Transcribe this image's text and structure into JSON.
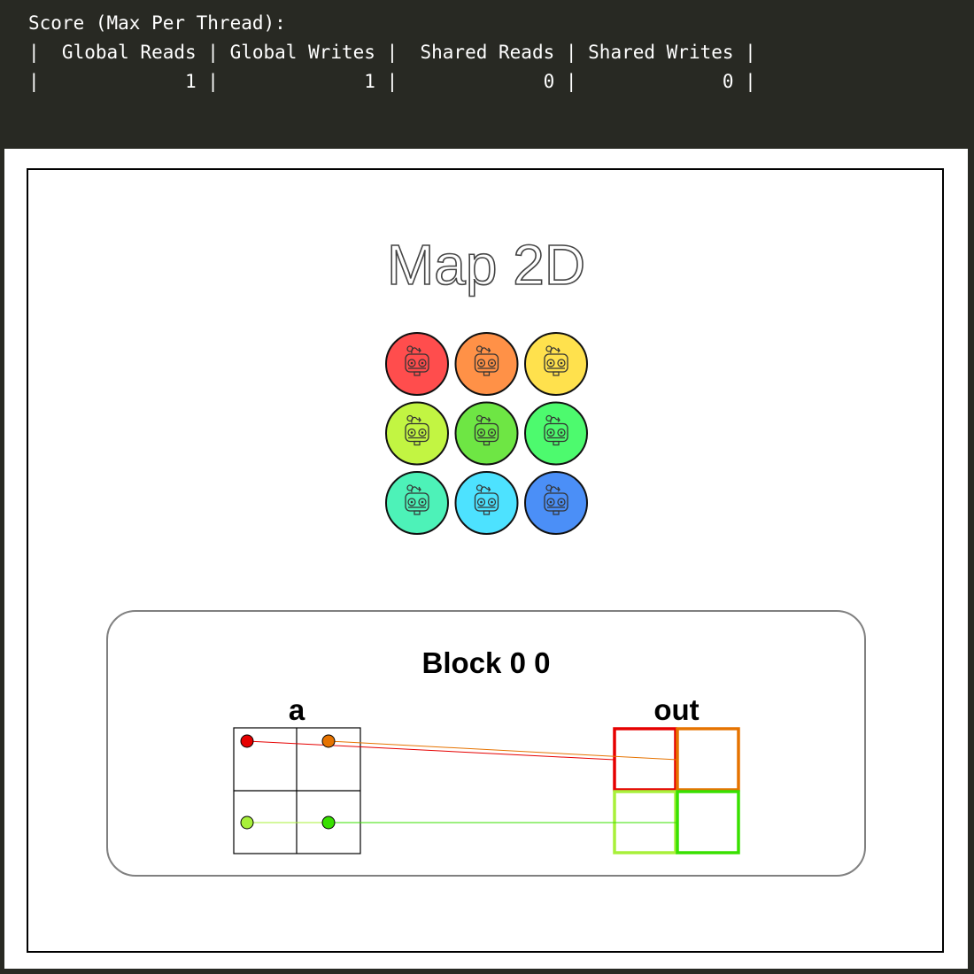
{
  "terminal": {
    "lines": [
      "Score (Max Per Thread):",
      "|  Global Reads | Global Writes |  Shared Reads | Shared Writes |",
      "|             1 |             1 |             0 |             0 |"
    ]
  },
  "score": {
    "global_reads": 1,
    "global_writes": 1,
    "shared_reads": 0,
    "shared_writes": 0
  },
  "diagram": {
    "title": "Map 2D",
    "block_label": "Block 0 0",
    "input_label": "a",
    "output_label": "out",
    "thread_colors": [
      "#ff4d4d",
      "#ff9147",
      "#ffe14d",
      "#c2f542",
      "#6ee644",
      "#4dfa6e",
      "#4df2b8",
      "#4de2ff",
      "#4b8ff7"
    ],
    "cell_colors": [
      "#e60000",
      "#e67300",
      "#a8f03a",
      "#38e000"
    ],
    "line_colors": [
      "#e60000",
      "#e67300",
      "#a8f03a",
      "#38e000"
    ]
  }
}
